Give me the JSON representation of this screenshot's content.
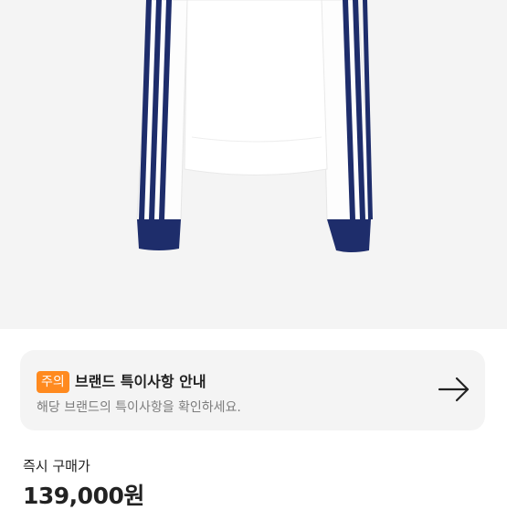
{
  "notice": {
    "badge": "주의",
    "title": "브랜드 특이사항 안내",
    "description": "해당 브랜드의 특이사항을 확인하세요."
  },
  "purchase": {
    "label": "즉시 구매가",
    "price": "139,000원"
  },
  "colors": {
    "badge": "#ff8a1f",
    "image_background": "#f4f4f4",
    "stripe": "#1e2d6b"
  },
  "icons": {
    "notice_arrow": "arrow-right-icon"
  }
}
